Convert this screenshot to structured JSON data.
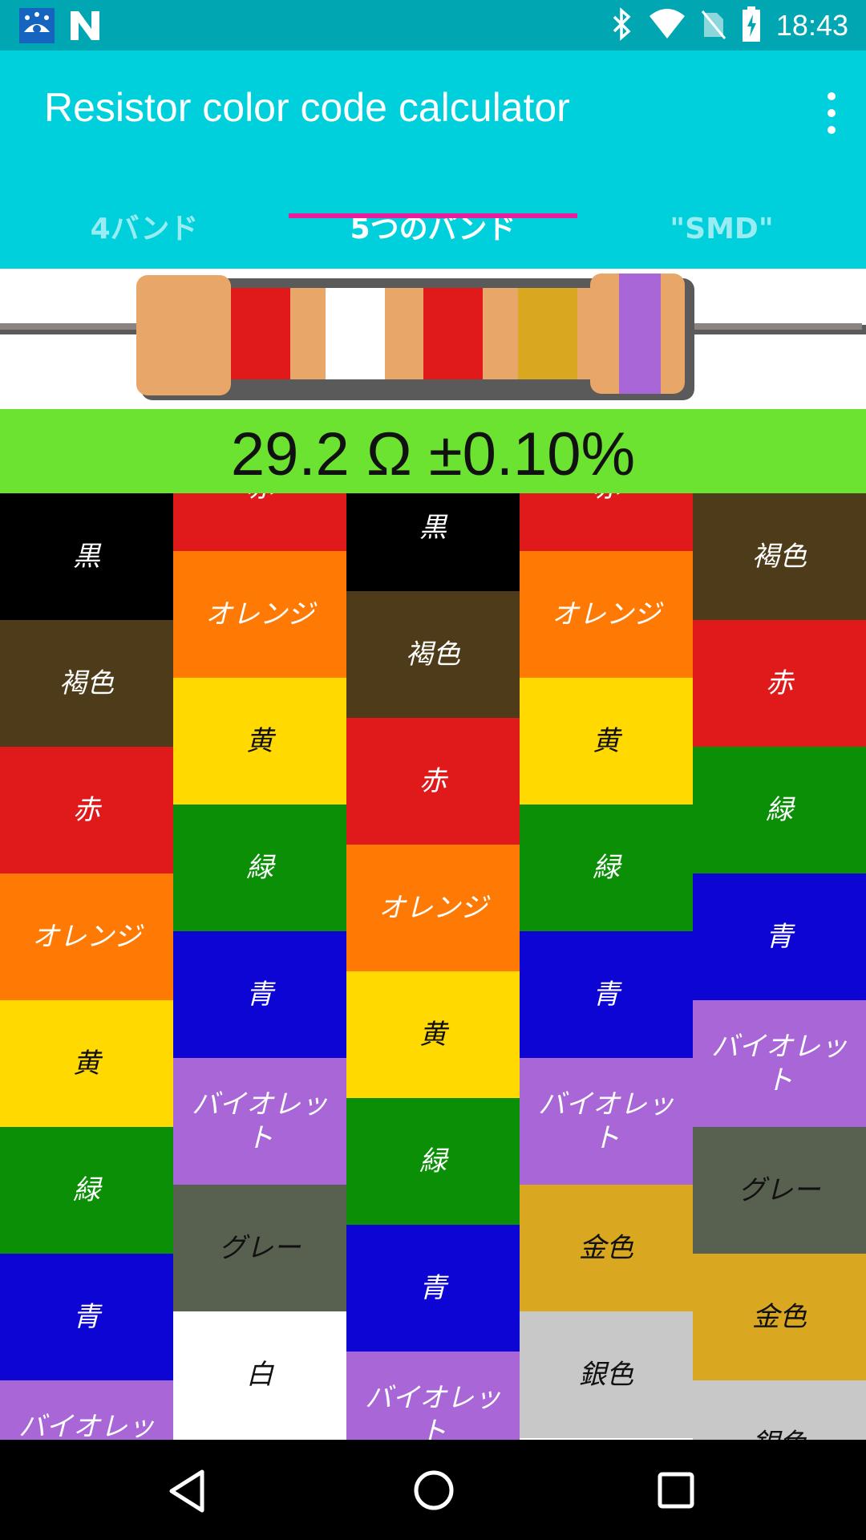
{
  "status_bar": {
    "time": "18:43",
    "icons": [
      "settings-gear-icon",
      "n-logo-icon",
      "bluetooth-icon",
      "wifi-icon",
      "no-sim-icon",
      "battery-charging-icon"
    ]
  },
  "app_bar": {
    "title": "Resistor color code calculator",
    "menu_icon": "more-vert-icon"
  },
  "tabs": [
    {
      "label": "4バンド",
      "active": false
    },
    {
      "label": "5つのバンド",
      "active": true
    },
    {
      "label": "\"SMD\"",
      "active": false
    }
  ],
  "resistor": {
    "body_color": "#e8a668",
    "bands": [
      "#e01a1a",
      "#ffffff",
      "#e01a1a",
      "#d9a820",
      "#a966d6"
    ]
  },
  "result": {
    "text": "29.2   Ω ±0.10%",
    "background": "#6ce330"
  },
  "colors": {
    "black": "#000000",
    "brown": "#4e3b1a",
    "red": "#e01a1a",
    "orange": "#ff7a05",
    "yellow": "#ffd900",
    "green": "#0a8f07",
    "blue": "#0c05d3",
    "violet": "#a966d6",
    "grey": "#58604f",
    "white": "#ffffff",
    "gold": "#d9a820",
    "silver": "#c8c8c8"
  },
  "columns": [
    {
      "cells": [
        {
          "label": "黒",
          "color": "black"
        },
        {
          "label": "褐色",
          "color": "brown"
        },
        {
          "label": "赤",
          "color": "red"
        },
        {
          "label": "オレンジ",
          "color": "orange"
        },
        {
          "label": "黄",
          "color": "yellow"
        },
        {
          "label": "緑",
          "color": "green"
        },
        {
          "label": "青",
          "color": "blue"
        },
        {
          "label": "バイオレット",
          "color": "violet"
        }
      ]
    },
    {
      "cells": [
        {
          "label": "赤",
          "color": "red"
        },
        {
          "label": "オレンジ",
          "color": "orange"
        },
        {
          "label": "黄",
          "color": "yellow"
        },
        {
          "label": "緑",
          "color": "green"
        },
        {
          "label": "青",
          "color": "blue"
        },
        {
          "label": "バイオレット",
          "color": "violet"
        },
        {
          "label": "グレー",
          "color": "grey"
        },
        {
          "label": "白",
          "color": "white"
        }
      ]
    },
    {
      "cells": [
        {
          "label": "黒",
          "color": "black"
        },
        {
          "label": "褐色",
          "color": "brown"
        },
        {
          "label": "赤",
          "color": "red"
        },
        {
          "label": "オレンジ",
          "color": "orange"
        },
        {
          "label": "黄",
          "color": "yellow"
        },
        {
          "label": "緑",
          "color": "green"
        },
        {
          "label": "青",
          "color": "blue"
        },
        {
          "label": "バイオレット",
          "color": "violet"
        }
      ]
    },
    {
      "cells": [
        {
          "label": "赤",
          "color": "red"
        },
        {
          "label": "オレンジ",
          "color": "orange"
        },
        {
          "label": "黄",
          "color": "yellow"
        },
        {
          "label": "緑",
          "color": "green"
        },
        {
          "label": "青",
          "color": "blue"
        },
        {
          "label": "バイオレット",
          "color": "violet"
        },
        {
          "label": "金色",
          "color": "gold"
        },
        {
          "label": "銀色",
          "color": "silver"
        }
      ]
    },
    {
      "cells": [
        {
          "label": "褐色",
          "color": "brown"
        },
        {
          "label": "赤",
          "color": "red"
        },
        {
          "label": "緑",
          "color": "green"
        },
        {
          "label": "青",
          "color": "blue"
        },
        {
          "label": "バイオレット",
          "color": "violet"
        },
        {
          "label": "グレー",
          "color": "grey"
        },
        {
          "label": "金色",
          "color": "gold"
        },
        {
          "label": "銀色",
          "color": "silver"
        }
      ]
    }
  ],
  "nav_bar": {
    "icons": [
      "back-icon",
      "home-icon",
      "recents-icon"
    ]
  }
}
